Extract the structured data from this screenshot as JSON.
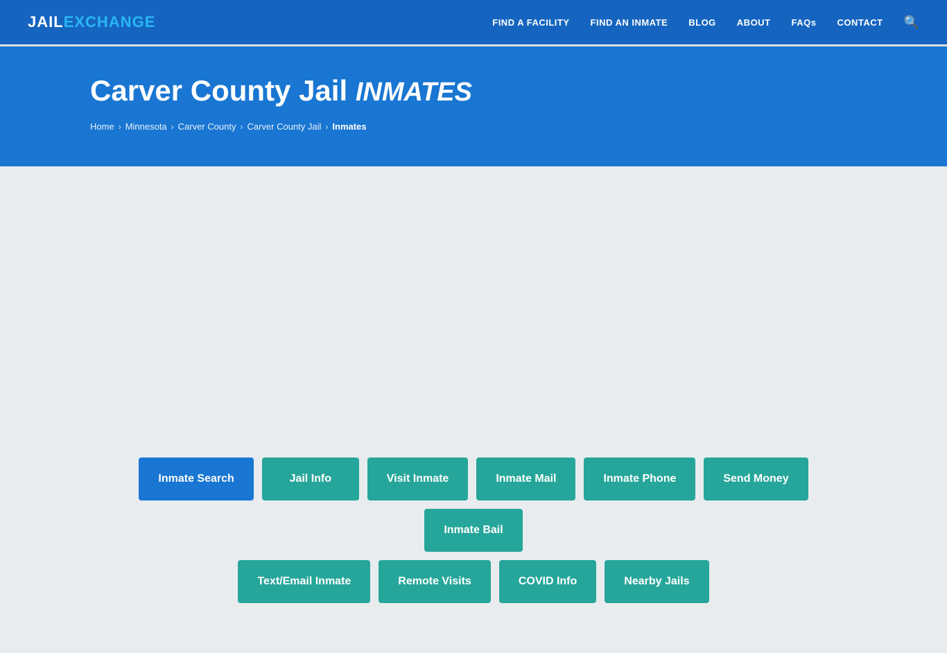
{
  "header": {
    "logo_jail": "JAIL",
    "logo_exchange": "EXCHANGE",
    "nav_items": [
      {
        "label": "FIND A FACILITY",
        "id": "find-facility"
      },
      {
        "label": "FIND AN INMATE",
        "id": "find-inmate"
      },
      {
        "label": "BLOG",
        "id": "blog"
      },
      {
        "label": "ABOUT",
        "id": "about"
      },
      {
        "label": "FAQs",
        "id": "faqs"
      },
      {
        "label": "CONTACT",
        "id": "contact"
      }
    ]
  },
  "hero": {
    "title_main": "Carver County Jail ",
    "title_italic": "INMATES",
    "breadcrumb": [
      {
        "label": "Home",
        "active": false
      },
      {
        "label": "Minnesota",
        "active": false
      },
      {
        "label": "Carver County",
        "active": false
      },
      {
        "label": "Carver County Jail",
        "active": false
      },
      {
        "label": "Inmates",
        "active": true
      }
    ]
  },
  "buttons": {
    "row1": [
      {
        "label": "Inmate Search",
        "style": "blue",
        "id": "inmate-search"
      },
      {
        "label": "Jail Info",
        "style": "teal",
        "id": "jail-info"
      },
      {
        "label": "Visit Inmate",
        "style": "teal",
        "id": "visit-inmate"
      },
      {
        "label": "Inmate Mail",
        "style": "teal",
        "id": "inmate-mail"
      },
      {
        "label": "Inmate Phone",
        "style": "teal",
        "id": "inmate-phone"
      },
      {
        "label": "Send Money",
        "style": "teal",
        "id": "send-money"
      },
      {
        "label": "Inmate Bail",
        "style": "teal",
        "id": "inmate-bail"
      }
    ],
    "row2": [
      {
        "label": "Text/Email Inmate",
        "style": "teal",
        "id": "text-email-inmate"
      },
      {
        "label": "Remote Visits",
        "style": "teal",
        "id": "remote-visits"
      },
      {
        "label": "COVID Info",
        "style": "teal",
        "id": "covid-info"
      },
      {
        "label": "Nearby Jails",
        "style": "teal",
        "id": "nearby-jails"
      }
    ]
  }
}
